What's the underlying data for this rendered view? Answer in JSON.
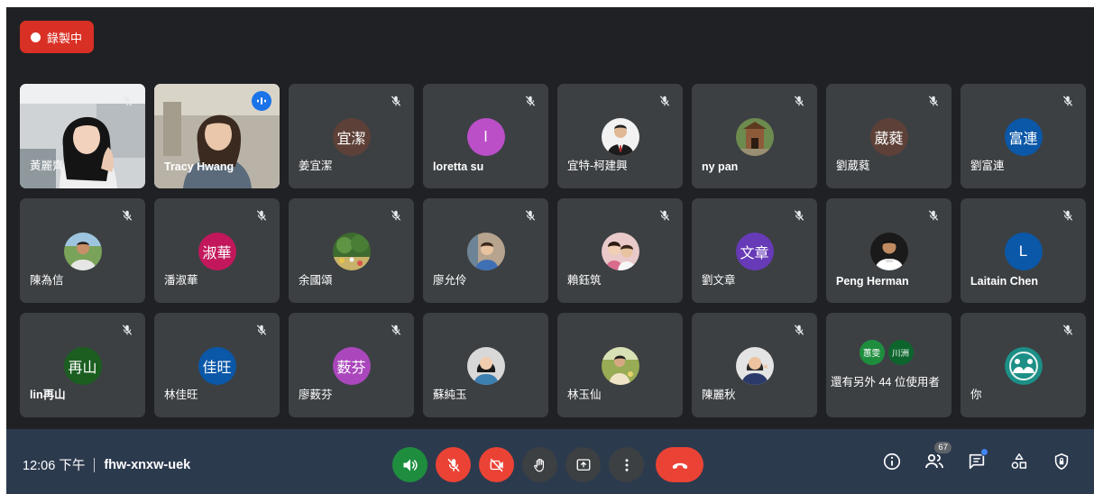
{
  "recording": {
    "label": "錄製中"
  },
  "participants": [
    {
      "name": "黃麗齊",
      "type": "video",
      "bold": false,
      "muted": true,
      "scene": "woman-office"
    },
    {
      "name": "Tracy Hwang",
      "type": "video",
      "bold": true,
      "muted": false,
      "speaking": true,
      "scene": "woman-home"
    },
    {
      "name": "姜宜潔",
      "type": "initials",
      "initials": "宜潔",
      "color": "#5d4037",
      "bold": false,
      "muted": true
    },
    {
      "name": "loretta su",
      "type": "initials",
      "initials": "l",
      "color": "#ba4fc8",
      "bold": true,
      "muted": true
    },
    {
      "name": "宜特-柯建興",
      "type": "photo",
      "photo": "man-suit",
      "bold": false,
      "muted": true
    },
    {
      "name": "ny pan",
      "type": "photo",
      "photo": "building",
      "bold": true,
      "muted": true
    },
    {
      "name": "劉葳蕤",
      "type": "initials",
      "initials": "葳蕤",
      "color": "#5d4037",
      "bold": false,
      "muted": true
    },
    {
      "name": "劉富連",
      "type": "initials",
      "initials": "富連",
      "color": "#0b57a8",
      "bold": false,
      "muted": true
    },
    {
      "name": "陳為信",
      "type": "photo",
      "photo": "man-outdoor",
      "bold": false,
      "muted": true
    },
    {
      "name": "潘淑華",
      "type": "initials",
      "initials": "淑華",
      "color": "#c2185b",
      "bold": false,
      "muted": true
    },
    {
      "name": "余國頌",
      "type": "photo",
      "photo": "garden",
      "bold": false,
      "muted": true
    },
    {
      "name": "廖允伶",
      "type": "photo",
      "photo": "child",
      "bold": false,
      "muted": true
    },
    {
      "name": "賴鈺筑",
      "type": "photo",
      "photo": "two-people",
      "bold": false,
      "muted": true
    },
    {
      "name": "劉文章",
      "type": "initials",
      "initials": "文章",
      "color": "#673ab7",
      "bold": false,
      "muted": true
    },
    {
      "name": "Peng Herman",
      "type": "photo",
      "photo": "athlete",
      "bold": true,
      "muted": true
    },
    {
      "name": "Laitain Chen",
      "type": "initials",
      "initials": "L",
      "color": "#0b57a8",
      "bold": true,
      "muted": true
    },
    {
      "name": "lin再山",
      "type": "initials",
      "initials": "再山",
      "color": "#1b5e20",
      "bold": true,
      "muted": true
    },
    {
      "name": "林佳旺",
      "type": "initials",
      "initials": "佳旺",
      "color": "#0b57a8",
      "bold": false,
      "muted": true
    },
    {
      "name": "廖薮芬",
      "type": "initials",
      "initials": "薮芬",
      "color": "#ab47bc",
      "bold": false,
      "muted": true
    },
    {
      "name": "蘇純玉",
      "type": "photo",
      "photo": "woman-portrait",
      "bold": false,
      "muted": false
    },
    {
      "name": "林玉仙",
      "type": "photo",
      "photo": "woman-field",
      "bold": false,
      "muted": false
    },
    {
      "name": "陳麗秋",
      "type": "photo",
      "photo": "woman-smile",
      "bold": false,
      "muted": true
    },
    {
      "name": "還有另外 44 位使用者",
      "type": "others",
      "mini": [
        {
          "initials": "蕙雯",
          "color": "#1e8e3e"
        },
        {
          "initials": "川洲",
          "color": "#0d652d"
        }
      ],
      "bold": false,
      "muted": false
    },
    {
      "name": "你",
      "type": "photo",
      "photo": "logo-teal",
      "bold": false,
      "muted": true
    }
  ],
  "bottom_bar": {
    "time": "12:06 下午",
    "meeting_code": "fhw-xnxw-uek",
    "people_count": "67",
    "colors": {
      "green": "#1e8e3e",
      "red": "#ea4335",
      "dark": "#3c4043",
      "bar": "#2c3a4e"
    }
  }
}
